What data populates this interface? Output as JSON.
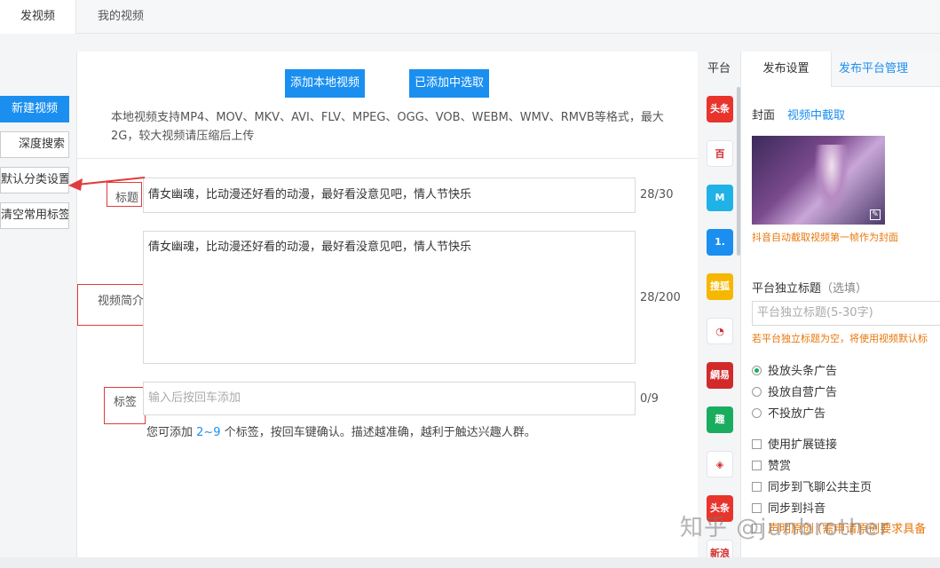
{
  "top_tabs": {
    "publish": "发视频",
    "my_videos": "我的视频"
  },
  "left_menu": {
    "new_video": "新建视频",
    "deep_search": "深度搜索",
    "default_category": "默认分类设置",
    "clear_tags": "清空常用标签"
  },
  "upload": {
    "add_local": "添加本地视频",
    "pick_added": "已添加中选取",
    "description": "本地视频支持MP4、MOV、MKV、AVI、FLV、MPEG、OGG、VOB、WEBM、WMV、RMVB等格式，最大2G，较大视频请压缩后上传"
  },
  "form": {
    "title_label": "标题",
    "title_value": "倩女幽魂，比动漫还好看的动漫，最好看没意见吧，情人节快乐",
    "title_count": "28/30",
    "intro_label": "视频简介",
    "intro_value": "倩女幽魂，比动漫还好看的动漫，最好看没意见吧，情人节快乐",
    "intro_count": "28/200",
    "tags_label": "标签",
    "tags_placeholder": "输入后按回车添加",
    "tags_count": "0/9",
    "hint_pre": "您可添加 ",
    "hint_range": "2~9",
    "hint_post": " 个标签，按回车键确认。描述越准确，越利于触达兴趣人群。"
  },
  "platforms": {
    "header": "平台",
    "items": [
      {
        "name": "toutiao",
        "glyph": "头条",
        "color": "#e8342c"
      },
      {
        "name": "baijia",
        "glyph": "百",
        "color": "#ffffff"
      },
      {
        "name": "xigua",
        "glyph": "M",
        "color": "#1fb2e7"
      },
      {
        "name": "yidian",
        "glyph": "1.",
        "color": "#1a8ff0"
      },
      {
        "name": "sohu",
        "glyph": "搜狐",
        "color": "#f5b700"
      },
      {
        "name": "dayu",
        "glyph": "◔",
        "color": "#ffffff"
      },
      {
        "name": "netease",
        "glyph": "網易",
        "color": "#d22a2a"
      },
      {
        "name": "qutoutiao",
        "glyph": "趣",
        "color": "#1aad5f"
      },
      {
        "name": "aiqiyi",
        "glyph": "◈",
        "color": "#ffffff"
      },
      {
        "name": "toutiao2",
        "glyph": "头条",
        "color": "#e8342c"
      },
      {
        "name": "sina",
        "glyph": "新浪",
        "color": "#ffffff"
      }
    ]
  },
  "settings": {
    "tab_publish": "发布设置",
    "tab_manage": "发布平台管理",
    "cover_label": "封面",
    "cover_link": "视频中截取",
    "cover_note": "抖音自动截取视频第一帧作为封面",
    "indep_title_label": "平台独立标题",
    "indep_title_optional": "（选填）",
    "indep_title_placeholder": "平台独立标题(5-30字)",
    "indep_title_note": "若平台独立标题为空，将使用视频默认标",
    "ads": [
      "投放头条广告",
      "投放自营广告",
      "不投放广告"
    ],
    "checks": [
      "使用扩展链接",
      "赞赏",
      "同步到飞聊公共主页",
      "同步到抖音"
    ],
    "bottom_note": "声明原创 (需申请原创要求具备"
  },
  "watermark": "知乎 @junbrother",
  "colors": {
    "accent": "#1a8ff0",
    "warning": "#e8770c",
    "annotation": "#e03c3c"
  }
}
